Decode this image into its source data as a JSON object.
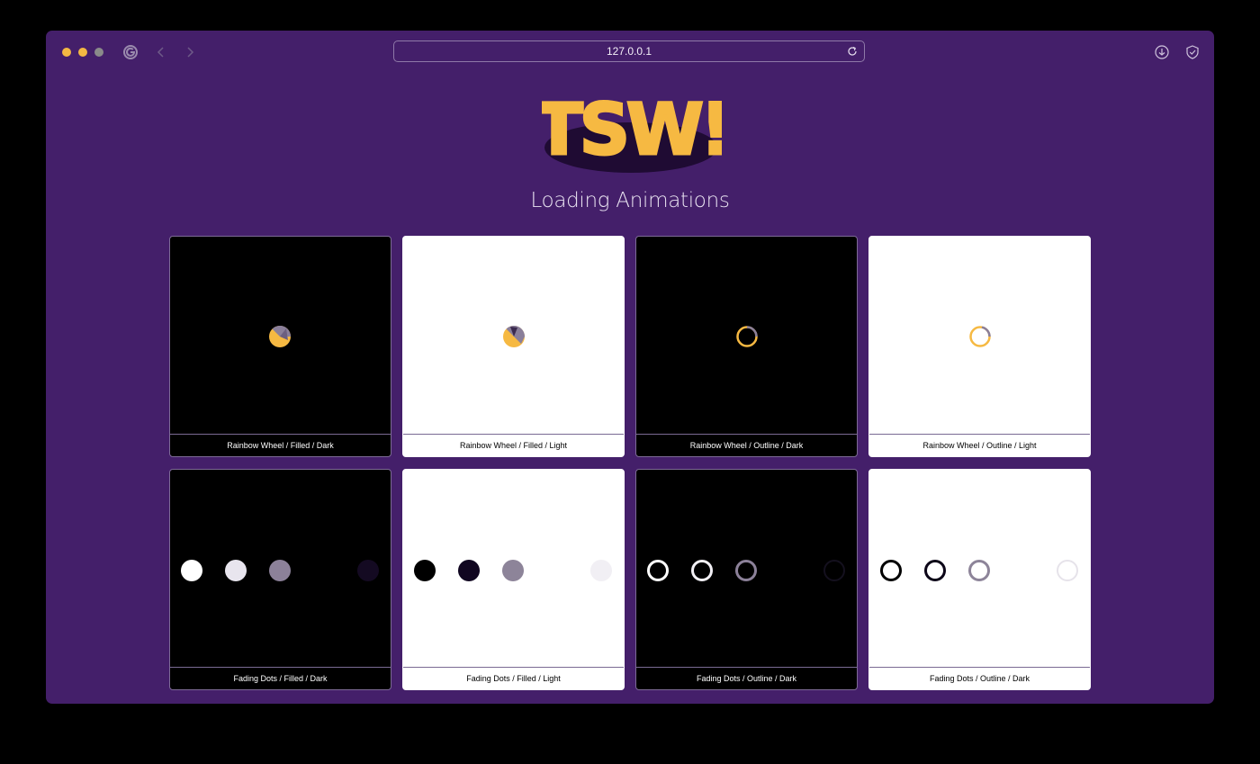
{
  "browser": {
    "url": "127.0.0.1",
    "colors": {
      "close": "#f3b843",
      "minimize": "#f3b843",
      "maximize": "#8a8a8a"
    },
    "icons": [
      "shield-g-icon",
      "back-arrow-icon",
      "forward-arrow-icon",
      "reload-icon",
      "download-icon",
      "shield-check-icon"
    ]
  },
  "page": {
    "logo_text": "TSW!",
    "title": "Loading Animations",
    "colors": {
      "background": "#441f6a",
      "accent": "#f6b942"
    }
  },
  "cards": [
    {
      "label": "Rainbow Wheel / Filled / Dark",
      "theme": "dark"
    },
    {
      "label": "Rainbow Wheel / Filled / Light",
      "theme": "light"
    },
    {
      "label": "Rainbow Wheel / Outline / Dark",
      "theme": "dark"
    },
    {
      "label": "Rainbow Wheel / Outline / Light",
      "theme": "light"
    },
    {
      "label": "Fading Dots / Filled / Dark",
      "theme": "dark"
    },
    {
      "label": "Fading Dots / Filled / Light",
      "theme": "light"
    },
    {
      "label": "Fading Dots / Outline / Dark",
      "theme": "dark"
    },
    {
      "label": "Fading Dots / Outline / Dark",
      "theme": "light"
    }
  ]
}
